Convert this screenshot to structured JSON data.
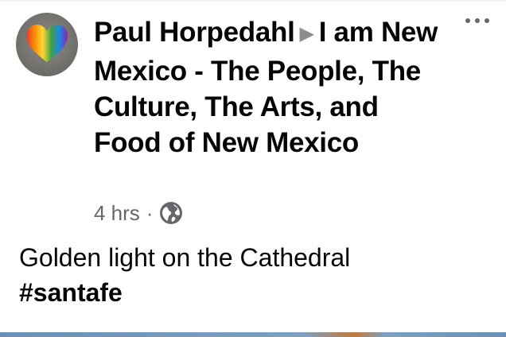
{
  "post": {
    "author": "Paul Horpedahl",
    "arrow": "▶",
    "group": "I am New Mexico - The People, The Culture, The Arts, and Food of New Mexico",
    "time": "4 hrs",
    "separator": "·",
    "privacy_icon": "globe-icon",
    "message": "Golden light on the Cathedral",
    "hashtag": "#santafe"
  },
  "icons": {
    "more": "more-options-icon"
  }
}
